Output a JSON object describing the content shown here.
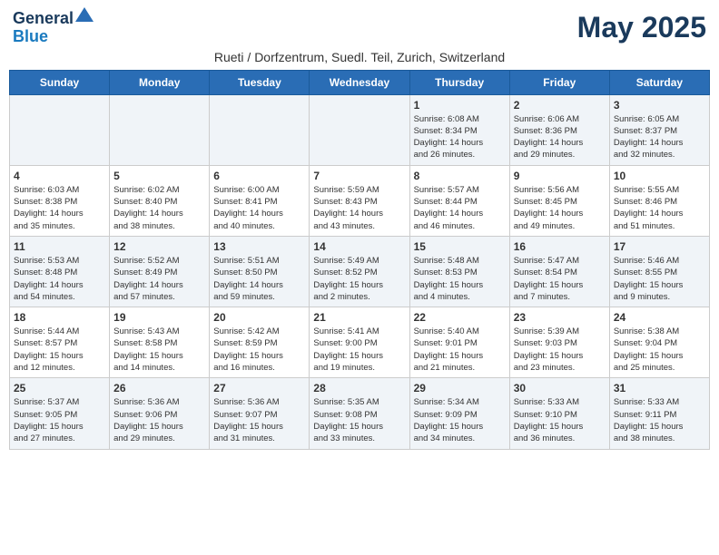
{
  "header": {
    "logo_line1": "General",
    "logo_line2": "Blue",
    "month_title": "May 2025",
    "subtitle": "Rueti / Dorfzentrum, Suedl. Teil, Zurich, Switzerland"
  },
  "days_of_week": [
    "Sunday",
    "Monday",
    "Tuesday",
    "Wednesday",
    "Thursday",
    "Friday",
    "Saturday"
  ],
  "weeks": [
    [
      {
        "day": "",
        "info": ""
      },
      {
        "day": "",
        "info": ""
      },
      {
        "day": "",
        "info": ""
      },
      {
        "day": "",
        "info": ""
      },
      {
        "day": "1",
        "info": "Sunrise: 6:08 AM\nSunset: 8:34 PM\nDaylight: 14 hours\nand 26 minutes."
      },
      {
        "day": "2",
        "info": "Sunrise: 6:06 AM\nSunset: 8:36 PM\nDaylight: 14 hours\nand 29 minutes."
      },
      {
        "day": "3",
        "info": "Sunrise: 6:05 AM\nSunset: 8:37 PM\nDaylight: 14 hours\nand 32 minutes."
      }
    ],
    [
      {
        "day": "4",
        "info": "Sunrise: 6:03 AM\nSunset: 8:38 PM\nDaylight: 14 hours\nand 35 minutes."
      },
      {
        "day": "5",
        "info": "Sunrise: 6:02 AM\nSunset: 8:40 PM\nDaylight: 14 hours\nand 38 minutes."
      },
      {
        "day": "6",
        "info": "Sunrise: 6:00 AM\nSunset: 8:41 PM\nDaylight: 14 hours\nand 40 minutes."
      },
      {
        "day": "7",
        "info": "Sunrise: 5:59 AM\nSunset: 8:43 PM\nDaylight: 14 hours\nand 43 minutes."
      },
      {
        "day": "8",
        "info": "Sunrise: 5:57 AM\nSunset: 8:44 PM\nDaylight: 14 hours\nand 46 minutes."
      },
      {
        "day": "9",
        "info": "Sunrise: 5:56 AM\nSunset: 8:45 PM\nDaylight: 14 hours\nand 49 minutes."
      },
      {
        "day": "10",
        "info": "Sunrise: 5:55 AM\nSunset: 8:46 PM\nDaylight: 14 hours\nand 51 minutes."
      }
    ],
    [
      {
        "day": "11",
        "info": "Sunrise: 5:53 AM\nSunset: 8:48 PM\nDaylight: 14 hours\nand 54 minutes."
      },
      {
        "day": "12",
        "info": "Sunrise: 5:52 AM\nSunset: 8:49 PM\nDaylight: 14 hours\nand 57 minutes."
      },
      {
        "day": "13",
        "info": "Sunrise: 5:51 AM\nSunset: 8:50 PM\nDaylight: 14 hours\nand 59 minutes."
      },
      {
        "day": "14",
        "info": "Sunrise: 5:49 AM\nSunset: 8:52 PM\nDaylight: 15 hours\nand 2 minutes."
      },
      {
        "day": "15",
        "info": "Sunrise: 5:48 AM\nSunset: 8:53 PM\nDaylight: 15 hours\nand 4 minutes."
      },
      {
        "day": "16",
        "info": "Sunrise: 5:47 AM\nSunset: 8:54 PM\nDaylight: 15 hours\nand 7 minutes."
      },
      {
        "day": "17",
        "info": "Sunrise: 5:46 AM\nSunset: 8:55 PM\nDaylight: 15 hours\nand 9 minutes."
      }
    ],
    [
      {
        "day": "18",
        "info": "Sunrise: 5:44 AM\nSunset: 8:57 PM\nDaylight: 15 hours\nand 12 minutes."
      },
      {
        "day": "19",
        "info": "Sunrise: 5:43 AM\nSunset: 8:58 PM\nDaylight: 15 hours\nand 14 minutes."
      },
      {
        "day": "20",
        "info": "Sunrise: 5:42 AM\nSunset: 8:59 PM\nDaylight: 15 hours\nand 16 minutes."
      },
      {
        "day": "21",
        "info": "Sunrise: 5:41 AM\nSunset: 9:00 PM\nDaylight: 15 hours\nand 19 minutes."
      },
      {
        "day": "22",
        "info": "Sunrise: 5:40 AM\nSunset: 9:01 PM\nDaylight: 15 hours\nand 21 minutes."
      },
      {
        "day": "23",
        "info": "Sunrise: 5:39 AM\nSunset: 9:03 PM\nDaylight: 15 hours\nand 23 minutes."
      },
      {
        "day": "24",
        "info": "Sunrise: 5:38 AM\nSunset: 9:04 PM\nDaylight: 15 hours\nand 25 minutes."
      }
    ],
    [
      {
        "day": "25",
        "info": "Sunrise: 5:37 AM\nSunset: 9:05 PM\nDaylight: 15 hours\nand 27 minutes."
      },
      {
        "day": "26",
        "info": "Sunrise: 5:36 AM\nSunset: 9:06 PM\nDaylight: 15 hours\nand 29 minutes."
      },
      {
        "day": "27",
        "info": "Sunrise: 5:36 AM\nSunset: 9:07 PM\nDaylight: 15 hours\nand 31 minutes."
      },
      {
        "day": "28",
        "info": "Sunrise: 5:35 AM\nSunset: 9:08 PM\nDaylight: 15 hours\nand 33 minutes."
      },
      {
        "day": "29",
        "info": "Sunrise: 5:34 AM\nSunset: 9:09 PM\nDaylight: 15 hours\nand 34 minutes."
      },
      {
        "day": "30",
        "info": "Sunrise: 5:33 AM\nSunset: 9:10 PM\nDaylight: 15 hours\nand 36 minutes."
      },
      {
        "day": "31",
        "info": "Sunrise: 5:33 AM\nSunset: 9:11 PM\nDaylight: 15 hours\nand 38 minutes."
      }
    ]
  ]
}
